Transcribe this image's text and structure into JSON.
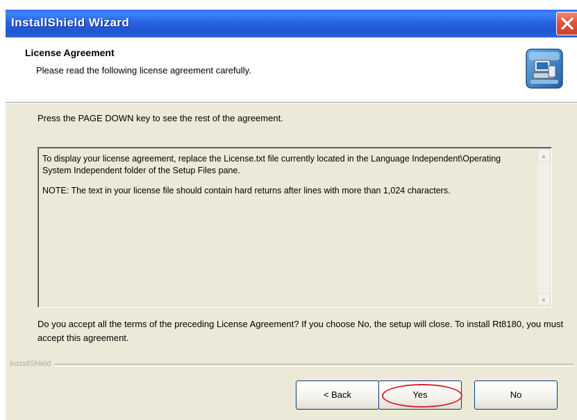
{
  "window": {
    "title": "InstallShield Wizard"
  },
  "header": {
    "title": "License Agreement",
    "subtitle": "Please read the following license agreement carefully."
  },
  "main": {
    "instruction": "Press the PAGE DOWN key to see the rest of the agreement.",
    "license_paragraphs": [
      "To display your license agreement, replace the License.txt file currently located in the Language Independent\\Operating System Independent folder of the Setup Files pane.",
      "NOTE: The text in your license file should contain hard returns after lines with more than 1,024 characters."
    ],
    "question": "Do you accept all the terms of the preceding License Agreement? If you choose No, the setup will close. To install Rt8180, you must accept this agreement."
  },
  "footer": {
    "brand": "InstallShield",
    "back_label": "< Back",
    "yes_label": "Yes",
    "no_label": "No"
  },
  "icons": {
    "close": "close-icon",
    "setup": "computer-setup-icon"
  },
  "colors": {
    "titlebar": "#2458d8",
    "dialog_bg": "#ece9d8",
    "highlight": "#d8232a"
  }
}
